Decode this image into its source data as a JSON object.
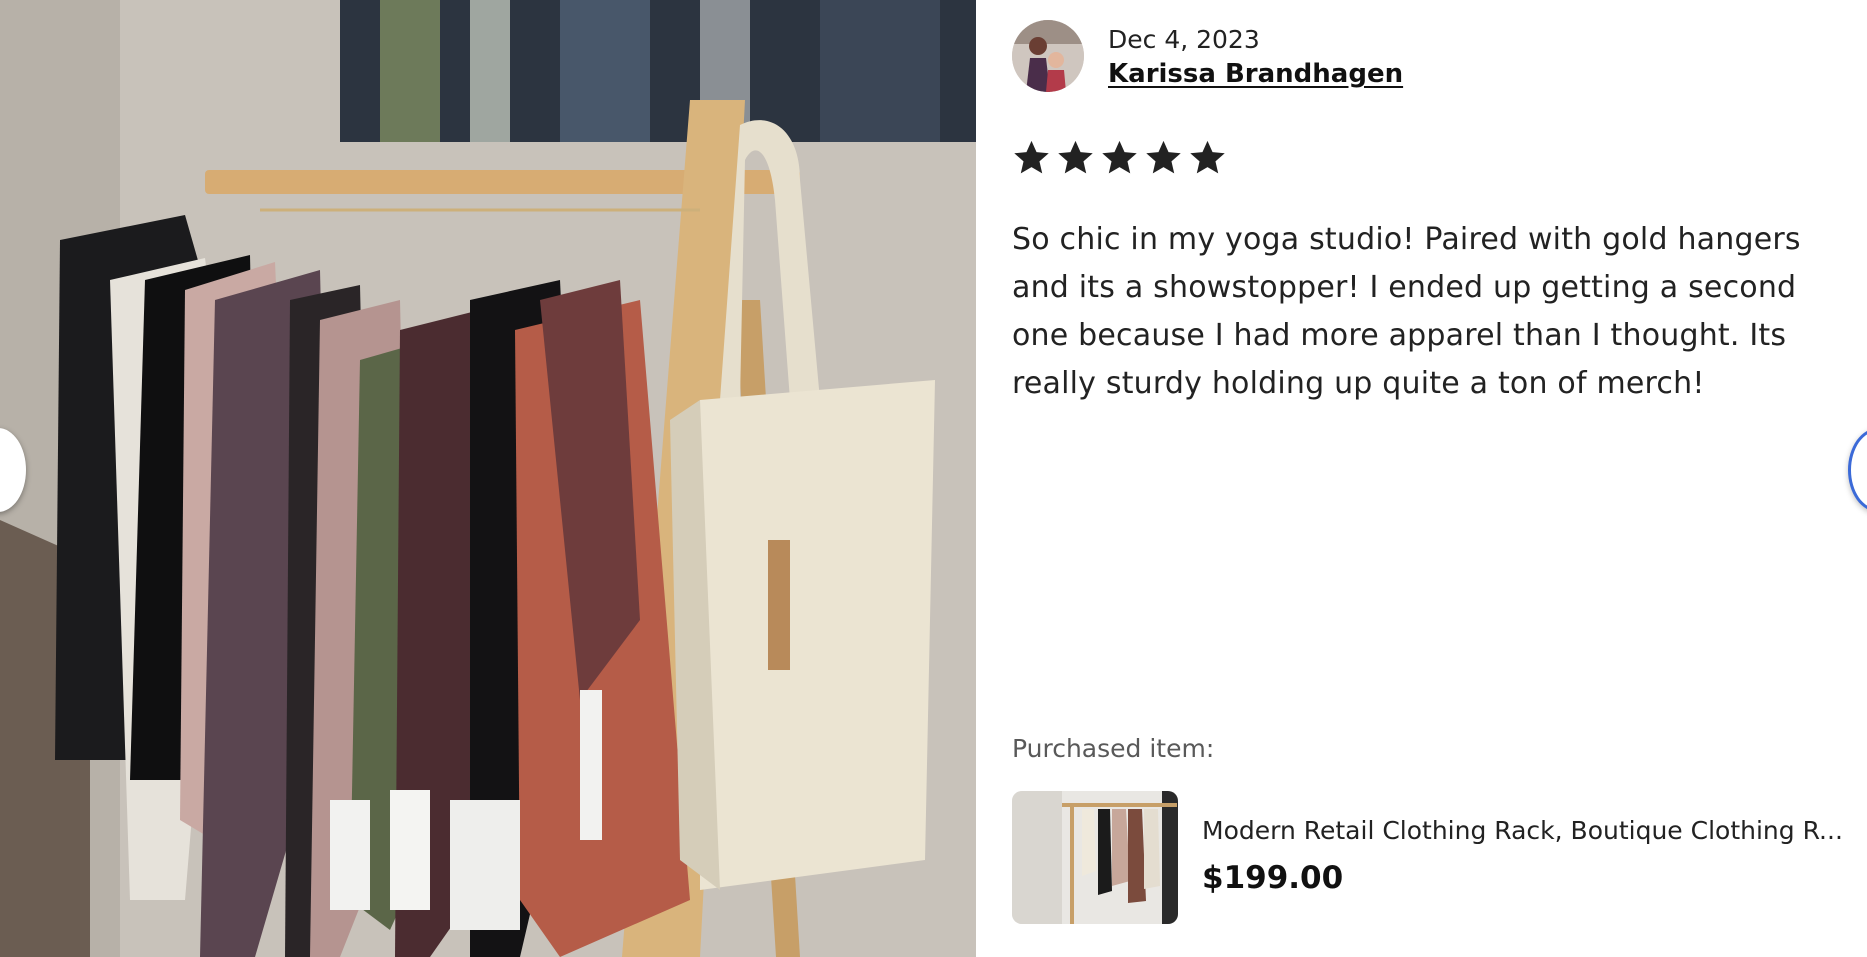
{
  "review": {
    "date": "Dec 4, 2023",
    "reviewer_name": "Karissa Brandhagen",
    "rating": 5,
    "rating_max": 5,
    "text": "So chic in my yoga studio! Paired with gold hangers and its a showstopper! I ended up getting a second one because I had more apparel than I thought. Its really sturdy holding up quite a ton of merch!"
  },
  "purchased": {
    "label": "Purchased item:",
    "title": "Modern Retail Clothing Rack, Boutique Clothing R...",
    "price": "$199.00"
  },
  "icons": {
    "star": "star-icon",
    "prev": "chevron-left-icon",
    "next": "chevron-right-icon"
  },
  "colors": {
    "text": "#222222",
    "muted": "#595959",
    "focus_ring": "#3b6ad8"
  }
}
